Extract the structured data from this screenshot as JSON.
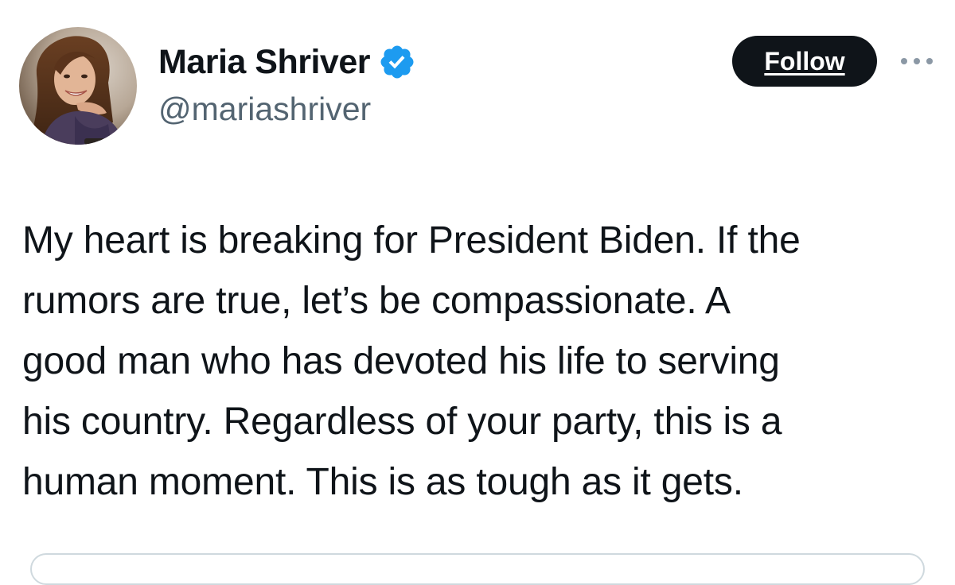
{
  "author": {
    "display_name": "Maria Shriver",
    "handle": "@mariashriver",
    "verified": true,
    "verified_icon": "verified-badge-icon",
    "avatar": "profile-photo"
  },
  "actions": {
    "follow_label": "Follow",
    "more_icon": "more-options-icon"
  },
  "tweet": {
    "lines": [
      "My heart is breaking for President Biden. If the",
      "rumors are true, let’s be compassionate. A",
      "good man who has devoted his life to serving",
      "his country. Regardless of your party, this is a",
      "human moment. This is as tough as it gets."
    ]
  },
  "colors": {
    "text_primary": "#0f1419",
    "text_secondary": "#536471",
    "verified_blue": "#1d9bf0",
    "follow_bg": "#0f1419",
    "border": "#cfd9de"
  }
}
